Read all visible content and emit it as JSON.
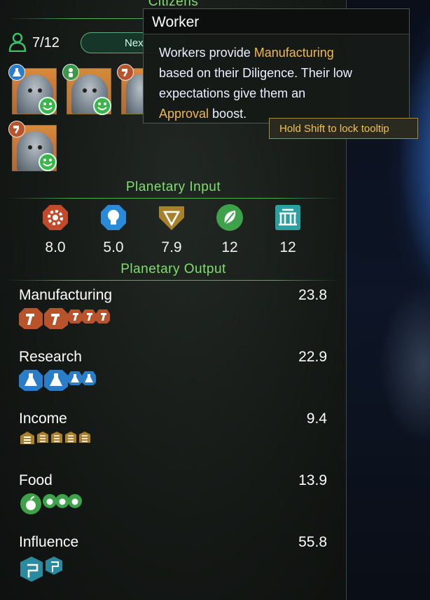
{
  "citizens": {
    "title": "Citizens",
    "population": "7/12",
    "next_label": "Nex"
  },
  "tooltip": {
    "title": "Worker",
    "line1_pre": "Workers provide ",
    "line1_hl": "Manufacturing",
    "line2": "based on their Diligence. Their low",
    "line3": "expectations give them an",
    "line4_hl": "Approval",
    "line4_post": " boost.",
    "hint": "Hold Shift to lock tooltip"
  },
  "planetary_input": {
    "title": "Planetary Input",
    "items": [
      {
        "icon": "manufacturing-gear-icon",
        "value": "8.0",
        "color": "#c24a2a"
      },
      {
        "icon": "research-bulb-icon",
        "value": "5.0",
        "color": "#2a8ad8"
      },
      {
        "icon": "income-diamond-icon",
        "value": "7.9",
        "color": "#a8812c"
      },
      {
        "icon": "food-leaf-icon",
        "value": "12",
        "color": "#3ea24a"
      },
      {
        "icon": "influence-building-icon",
        "value": "12",
        "color": "#2aa0a0"
      }
    ]
  },
  "planetary_output": {
    "title": "Planetary Output",
    "rows": [
      {
        "name": "Manufacturing",
        "value": "23.8",
        "color": "#b8532c"
      },
      {
        "name": "Research",
        "value": "22.9",
        "color": "#2a7dc8"
      },
      {
        "name": "Income",
        "value": "9.4",
        "color": "#a8812c"
      },
      {
        "name": "Food",
        "value": "13.9",
        "color": "#3ea24a"
      },
      {
        "name": "Influence",
        "value": "55.8",
        "color": "#2a8aa0"
      }
    ]
  }
}
